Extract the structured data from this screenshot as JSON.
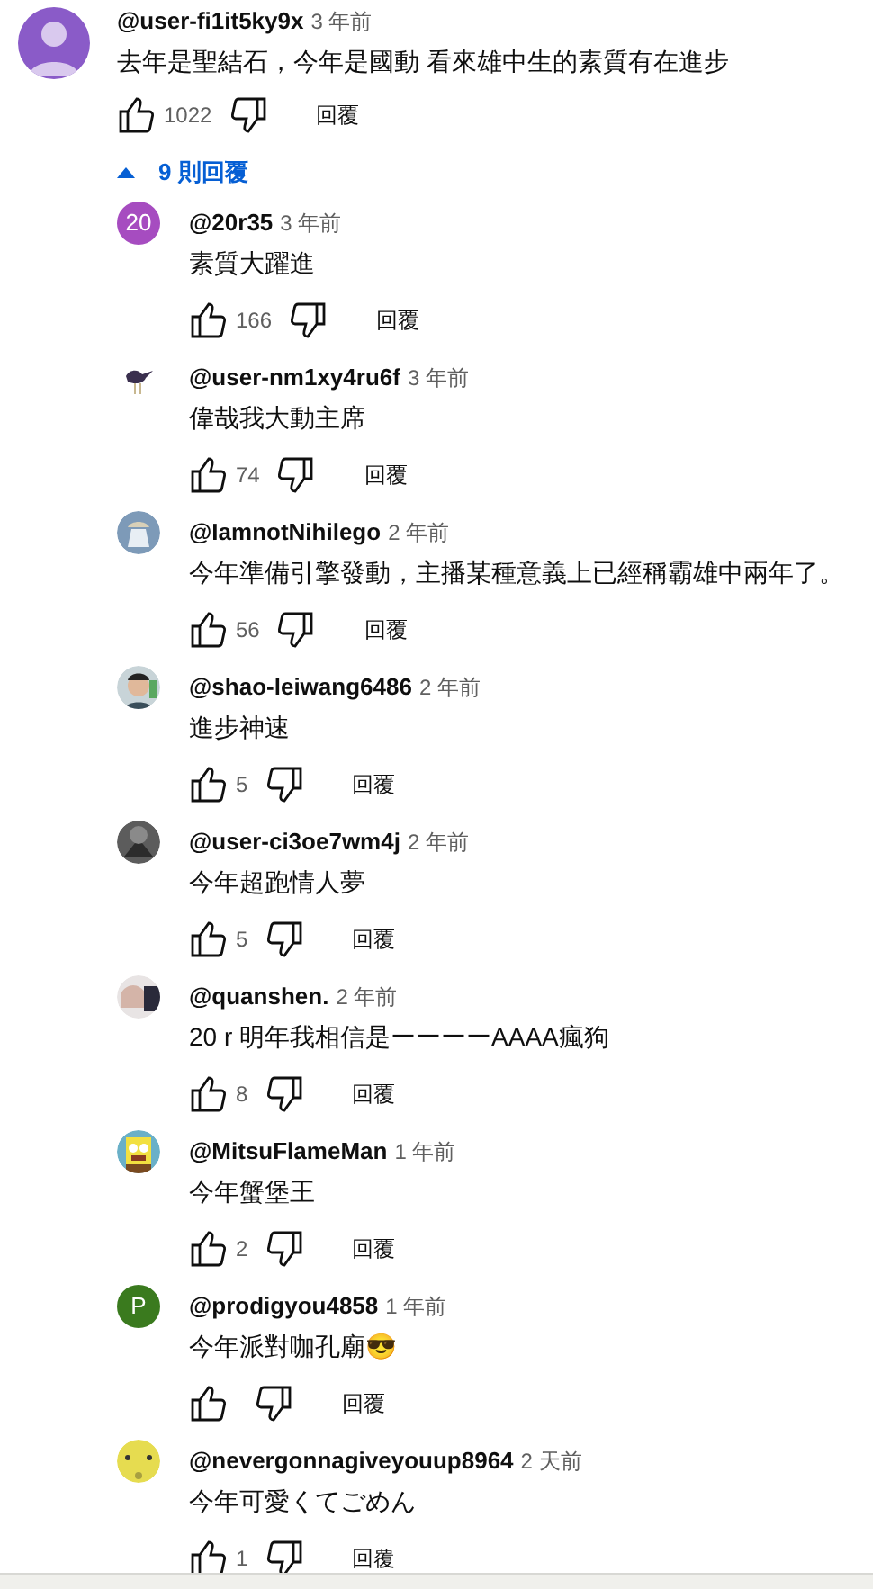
{
  "comment": {
    "avatar": {
      "kind": "silhouette",
      "color": "#8a5bc8"
    },
    "author": "@user-fi1it5ky9x",
    "time": "3 年前",
    "text": "去年是聖結石，今年是國動 看來雄中生的素質有在進步",
    "likes": "1022",
    "reply_label": "回覆"
  },
  "replies_toggle": {
    "label": "9 則回覆",
    "expanded": true
  },
  "replies": [
    {
      "avatar": {
        "kind": "letter",
        "text": "20",
        "color": "#a64cc0"
      },
      "author": "@20r35",
      "time": "3 年前",
      "text": "素質大躍進",
      "likes": "166",
      "reply_label": "回覆"
    },
    {
      "author": "@user-nm1xy4ru6f",
      "time": "3 年前",
      "text": "偉哉我大動主席",
      "likes": "74",
      "reply_label": "回覆"
    },
    {
      "author": "@IamnotNihilego",
      "time": "2 年前",
      "text": "今年準備引擎發動，主播某種意義上已經稱霸雄中兩年了。",
      "likes": "56",
      "reply_label": "回覆"
    },
    {
      "author": "@shao-leiwang6486",
      "time": "2 年前",
      "text": "進步神速",
      "likes": "5",
      "reply_label": "回覆"
    },
    {
      "author": "@user-ci3oe7wm4j",
      "time": "2 年前",
      "text": "今年超跑情人夢",
      "likes": "5",
      "reply_label": "回覆"
    },
    {
      "author": "@quanshen.",
      "time": "2 年前",
      "text": "20 r  明年我相信是ーーーーAAAA瘋狗",
      "likes": "8",
      "reply_label": "回覆"
    },
    {
      "author": "@MitsuFlameMan",
      "time": "1 年前",
      "text": "今年蟹堡王",
      "likes": "2",
      "reply_label": "回覆"
    },
    {
      "avatar": {
        "kind": "letter",
        "text": "P",
        "color": "#3a7a1e"
      },
      "author": "@prodigyou4858",
      "time": "1 年前",
      "text": "今年派對咖孔廟😎",
      "reply_label": "回覆"
    },
    {
      "author": "@nevergonnagiveyouup8964",
      "time": "2 天前",
      "text": "今年可愛くてごめん",
      "likes": "1",
      "reply_label": "回覆"
    }
  ]
}
